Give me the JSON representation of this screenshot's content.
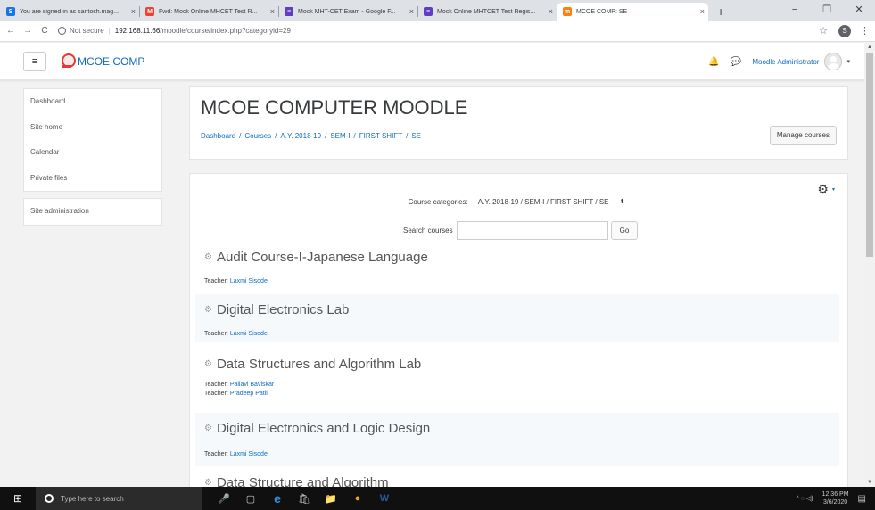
{
  "browser": {
    "tabs": [
      {
        "title": "You are signed in as santosh.mag...",
        "favicon": "S",
        "color": "#1a73e8",
        "active": false
      },
      {
        "title": "Fwd: Mock Online MHCET Test R...",
        "favicon": "M",
        "color": "#ea4335",
        "active": false
      },
      {
        "title": "Mock MHT-CET Exam - Google F...",
        "favicon": "≡",
        "color": "#5f3dc4",
        "active": false
      },
      {
        "title": "Mock Online MHTCET Test Regis...",
        "favicon": "≡",
        "color": "#5f3dc4",
        "active": false
      },
      {
        "title": "MCOE COMP: SE",
        "favicon": "m",
        "color": "#f98012",
        "active": true
      }
    ],
    "close_glyph": "×",
    "newtab_glyph": "+",
    "window": {
      "minimize": "−",
      "maximize": "❐",
      "close": "✕"
    },
    "back": "←",
    "forward": "→",
    "reload": "C",
    "info_glyph": "i",
    "security": "Not secure",
    "host": "192.168.11.66",
    "path": "/moodle/course/index.php?categoryid=29",
    "star": "☆",
    "profile_initial": "S",
    "menu": "⋮"
  },
  "navbar": {
    "menu_glyph": "≡",
    "site_name": "MCOE COMP",
    "bell": "🔔",
    "chat": "💬",
    "user_name": "Moodle Administrator",
    "caret": "▾"
  },
  "sidebar": {
    "items": [
      "Dashboard",
      "Site home",
      "Calendar",
      "Private files"
    ],
    "admin": "Site administration"
  },
  "header": {
    "title": "MCOE COMPUTER MOODLE",
    "breadcrumb": [
      "Dashboard",
      "Courses",
      "A.Y. 2018-19",
      "SEM-I",
      "FIRST SHIFT",
      "SE"
    ],
    "separator": "/",
    "manage_button": "Manage courses"
  },
  "main": {
    "gear": "⚙",
    "gear_caret": "▾",
    "category_label": "Course categories:",
    "category_value": "A.Y. 2018-19 / SEM-I / FIRST SHIFT / SE",
    "category_arrow": "⬍",
    "search_label": "Search courses",
    "search_value": "",
    "go_button": "Go",
    "course_icon": "⚙",
    "teacher_label": "Teacher:",
    "courses": [
      {
        "name": "Audit Course-I-Japanese Language",
        "teachers": [
          "Laxmi Sisode"
        ]
      },
      {
        "name": "Digital Electronics Lab",
        "teachers": [
          "Laxmi Sisode"
        ]
      },
      {
        "name": "Data Structures and Algorithm Lab",
        "teachers": [
          "Pallavi Baviskar",
          "Pradeep Patil"
        ]
      },
      {
        "name": "Digital Electronics and Logic Design",
        "teachers": [
          "Laxmi Sisode"
        ]
      },
      {
        "name": "Data Structure and Algorithm",
        "teachers": []
      }
    ]
  },
  "taskbar": {
    "start": "⊞",
    "search_placeholder": "Type here to search",
    "icons": [
      "🎤",
      "▢",
      "e",
      "🛍",
      "📁",
      "●",
      "W"
    ],
    "tray_icons": "^ ◌ ◁)",
    "time": "12:36 PM",
    "date": "3/6/2020",
    "notification": "▤"
  }
}
